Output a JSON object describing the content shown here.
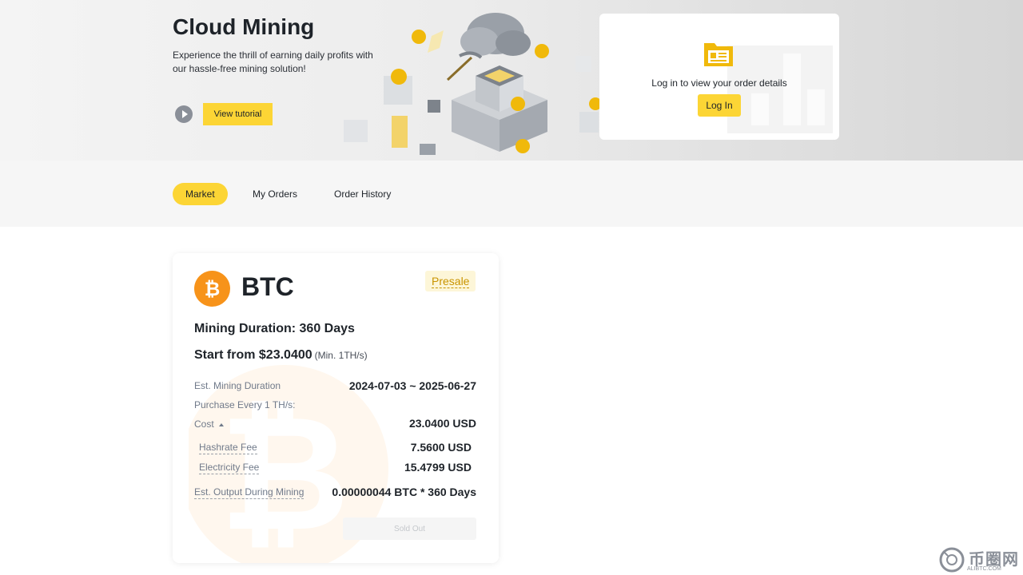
{
  "hero": {
    "title": "Cloud Mining",
    "subtitle": "Experience the thrill of earning daily profits with our hassle-free mining solution!",
    "tutorial_label": "View tutorial",
    "play_icon": "play-icon",
    "illustration_icon": "mining-illustration-icon"
  },
  "login_card": {
    "message": "Log in to view your order details",
    "button_label": "Log In",
    "icon": "folder-icon"
  },
  "tabs": [
    {
      "label": "Market",
      "active": true
    },
    {
      "label": "My Orders",
      "active": false
    },
    {
      "label": "Order History",
      "active": false
    }
  ],
  "product": {
    "coin_icon": "bitcoin-icon",
    "coin": "BTC",
    "badge": "Presale",
    "duration": "Mining Duration: 360 Days",
    "price": "Start from $23.0400",
    "min": "(Min. 1TH/s)",
    "est_duration_label": "Est. Mining Duration",
    "est_duration_value": "2024-07-03 ~ 2025-06-27",
    "purchase_label": "Purchase Every 1 TH/s:",
    "cost_label": "Cost",
    "cost_value": "23.0400 USD",
    "hashrate_label": "Hashrate Fee",
    "hashrate_value": "7.5600 USD",
    "electricity_label": "Electricity Fee",
    "electricity_value": "15.4799 USD",
    "output_label": "Est. Output During Mining",
    "output_value": "0.00000044 BTC * 360 Days",
    "button_label": "Sold Out"
  },
  "site_badge": {
    "name": "币圈网",
    "domain": "ALIBTC.COM",
    "icon": "site-logo-icon"
  },
  "colors": {
    "accent": "#fcd535",
    "btc": "#f7931a",
    "presale_text": "#c99400"
  }
}
